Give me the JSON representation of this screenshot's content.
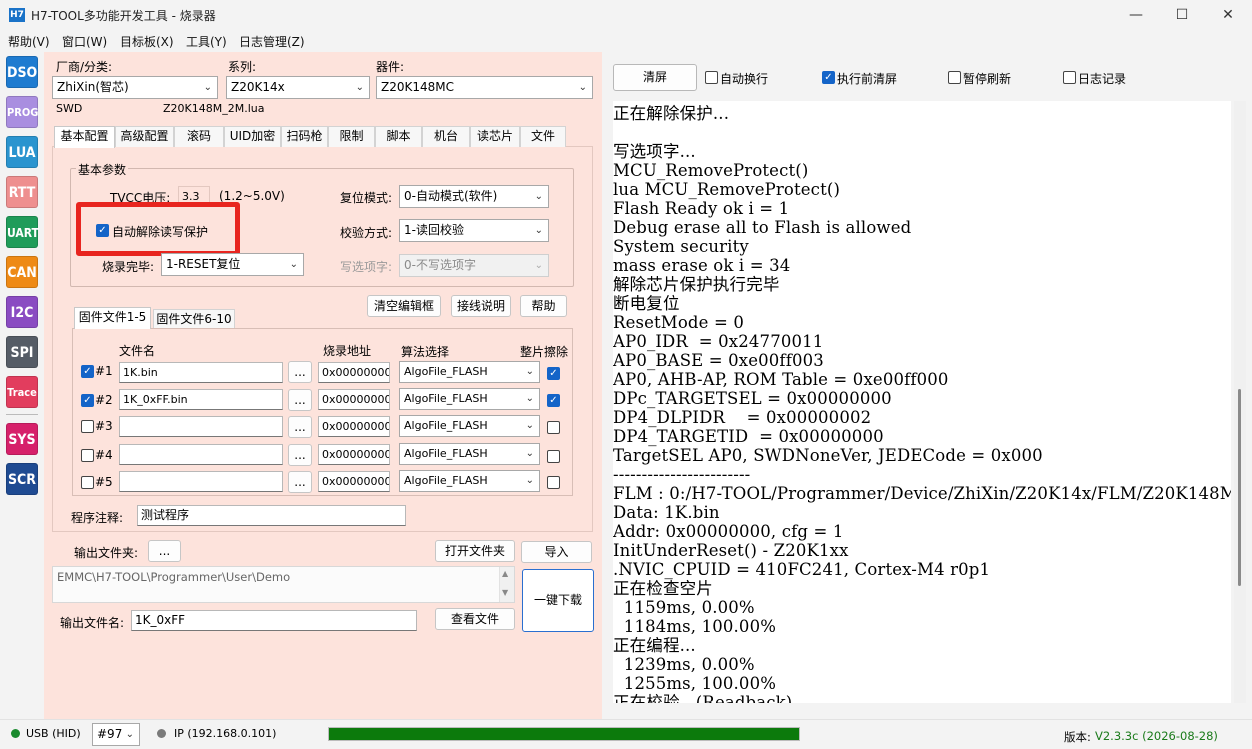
{
  "window": {
    "icon": "H7",
    "title": "H7-TOOL多功能开发工具 - 烧录器"
  },
  "menu": [
    "帮助(V)",
    "窗口(W)",
    "目标板(X)",
    "工具(Y)",
    "日志管理(Z)"
  ],
  "sidebar": [
    {
      "label": "DSO",
      "color": "#1e7bd0"
    },
    {
      "label": "PROG",
      "color": "#a98ee0"
    },
    {
      "label": "LUA",
      "color": "#2a94cf"
    },
    {
      "label": "RTT",
      "color": "#ee8f8f"
    },
    {
      "label": "UART",
      "color": "#1f9c5a"
    },
    {
      "label": "CAN",
      "color": "#ee8a16"
    },
    {
      "label": "I2C",
      "color": "#8a4bc2"
    },
    {
      "label": "SPI",
      "color": "#555c66"
    },
    {
      "label": "Trace",
      "color": "#e23d5e"
    },
    {
      "label": "SYS",
      "color": "#d6206a"
    },
    {
      "label": "SCR",
      "color": "#1f4b92"
    }
  ],
  "device": {
    "vendor_label": "厂商/分类:",
    "vendor_value": "ZhiXin(智芯)",
    "series_label": "系列:",
    "series_value": "Z20K14x",
    "part_label": "器件:",
    "part_value": "Z20K148MC",
    "interface": "SWD",
    "lua_file": "Z20K148M_2M.lua"
  },
  "tabs": [
    "基本配置",
    "高级配置",
    "滚码",
    "UID加密",
    "扫码枪",
    "限制",
    "脚本",
    "机台",
    "读芯片",
    "文件"
  ],
  "basic": {
    "group_title": "基本参数",
    "tvcc_label": "TVCC电压:",
    "tvcc_value": "3.3",
    "tvcc_range": "(1.2~5.0V)",
    "auto_unprotect_label": "自动解除读写保护",
    "burn_done_label": "烧录完毕:",
    "burn_done_value": "1-RESET复位",
    "reset_mode_label": "复位模式:",
    "reset_mode_value": "0-自动模式(软件)",
    "verify_label": "校验方式:",
    "verify_value": "1-读回校验",
    "option_label": "写选项字:",
    "option_value": "0-不写选项字"
  },
  "buttons": {
    "clear_editor": "清空编辑框",
    "wiring": "接线说明",
    "help": "帮助",
    "browse": "...",
    "open_folder": "打开文件夹",
    "import": "导入",
    "view_file": "查看文件",
    "one_click": "一键下载"
  },
  "file_tabs": [
    "固件文件1-5",
    "固件文件6-10"
  ],
  "file_table": {
    "headers": {
      "name": "文件名",
      "addr": "烧录地址",
      "algo": "算法选择",
      "erase": "整片擦除"
    },
    "rows": [
      {
        "index": "#1",
        "checked": true,
        "file": "1K.bin",
        "addr": "0x00000000",
        "algo": "AlgoFile_FLASH",
        "erase": true
      },
      {
        "index": "#2",
        "checked": true,
        "file": "1K_0xFF.bin",
        "addr": "0x00000000",
        "algo": "AlgoFile_FLASH",
        "erase": true
      },
      {
        "index": "#3",
        "checked": false,
        "file": "",
        "addr": "0x00000000",
        "algo": "AlgoFile_FLASH",
        "erase": false
      },
      {
        "index": "#4",
        "checked": false,
        "file": "",
        "addr": "0x00000000",
        "algo": "AlgoFile_FLASH",
        "erase": false
      },
      {
        "index": "#5",
        "checked": false,
        "file": "",
        "addr": "0x00000000",
        "algo": "AlgoFile_FLASH",
        "erase": false
      }
    ]
  },
  "program_note": {
    "label": "程序注释:",
    "value": "测试程序"
  },
  "output": {
    "folder_label": "输出文件夹:",
    "folder_path": "EMMC\\H7-TOOL\\Programmer\\User\\Demo",
    "filename_label": "输出文件名:",
    "filename_value": "1K_0xFF"
  },
  "log_toolbar": {
    "clear": "清屏",
    "auto_wrap": "自动换行",
    "clear_before": "执行前清屏",
    "pause": "暂停刷新",
    "log_record": "日志记录"
  },
  "log_lines": [
    "正在解除保护...",
    "",
    "写选项字...",
    "MCU_RemoveProtect()",
    "lua MCU_RemoveProtect()",
    "Flash Ready ok i = 1",
    "Debug erase all to Flash is allowed",
    "System security",
    "mass erase ok i = 34",
    "解除芯片保护执行完毕",
    "断电复位",
    "ResetMode = 0",
    "AP0_IDR  = 0x24770011",
    "AP0_BASE = 0xe00ff003",
    "AP0, AHB-AP, ROM Table = 0xe00ff000",
    "DPc_TARGETSEL = 0x00000000",
    "DP4_DLPIDR    = 0x00000002",
    "DP4_TARGETID  = 0x00000000",
    "TargetSEL AP0, SWDNoneVer, JEDECode = 0x000",
    "------------------------",
    "FLM : 0:/H7-TOOL/Programmer/Device/ZhiXin/Z20K14x/FLM/Z20K148M",
    "Data: 1K.bin",
    "Addr: 0x00000000, cfg = 1",
    "InitUnderReset() - Z20K1xx",
    ".NVIC_CPUID = 410FC241, Cortex-M4 r0p1",
    "正在检查空片",
    "  1159ms, 0.00%",
    "  1184ms, 100.00%",
    "正在编程...",
    "  1239ms, 0.00%",
    "  1255ms, 100.00%",
    "正在校验...(Readback)"
  ],
  "status": {
    "usb": "USB (HID)",
    "device_no": "#97",
    "ip": "IP (192.168.0.101)",
    "progress": 1.0,
    "version_label": "版本:",
    "version_value": "V2.3.3c (2026-08-28)"
  }
}
